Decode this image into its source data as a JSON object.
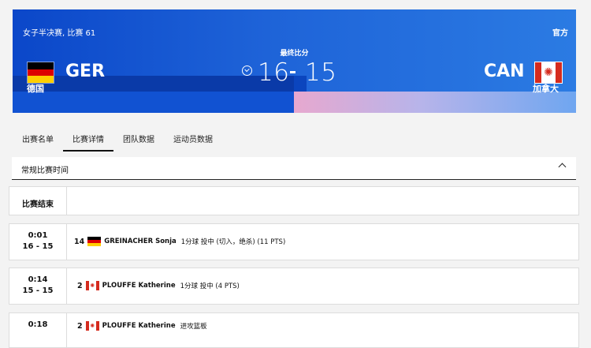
{
  "header": {
    "event": "女子半决赛, 比赛 61",
    "official": "官方",
    "score_label": "最终比分",
    "home": {
      "code": "GER",
      "name": "德国",
      "score": "16"
    },
    "away": {
      "code": "CAN",
      "name": "加拿大",
      "score": "15"
    }
  },
  "tabs": [
    {
      "label": "出赛名单"
    },
    {
      "label": "比赛详情"
    },
    {
      "label": "团队数据"
    },
    {
      "label": "运动员数据"
    }
  ],
  "section": {
    "title": "常规比赛时间"
  },
  "rows": [
    {
      "time": "比赛结束",
      "score": "",
      "num": "",
      "player": "",
      "action": ""
    },
    {
      "time": "0:01",
      "score": "16 - 15",
      "num": "14",
      "player": "GREINACHER Sonja",
      "action": "1分球 投中 (切入，绝杀) (11 PTS)"
    },
    {
      "time": "0:14",
      "score": "15 - 15",
      "num": "2",
      "player": "PLOUFFE Katherine",
      "action": "1分球 投中 (4 PTS)"
    },
    {
      "time": "0:18",
      "score": "",
      "num": "2",
      "player": "PLOUFFE Katherine",
      "action": "进攻篮板"
    }
  ],
  "colors": {
    "brand_blue": "#1e63d8",
    "germany": [
      "#000000",
      "#dd0000",
      "#ffce00"
    ],
    "canada_red": "#d52b1e"
  }
}
